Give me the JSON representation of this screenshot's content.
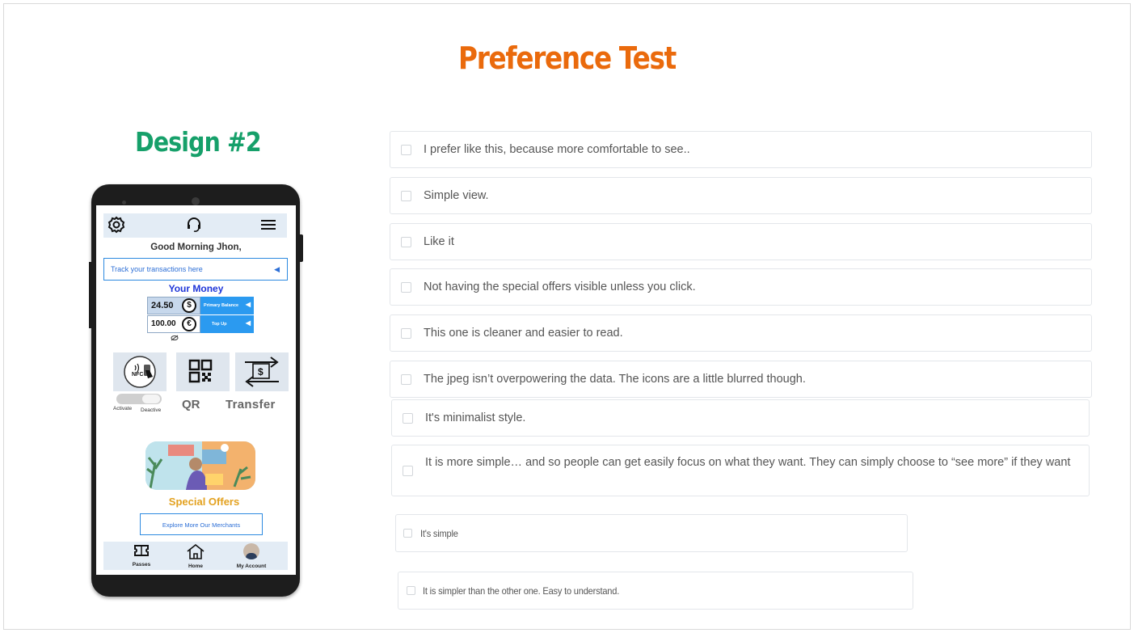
{
  "page": {
    "title": "Preference Test",
    "design_label": "Design #2"
  },
  "phone": {
    "greeting": "Good Morning Jhon,",
    "track_text": "Track your transactions here",
    "money_title": "Your Money",
    "balances": [
      {
        "amount": "24.50",
        "currency_symbol": "$",
        "action": "Primary Balance"
      },
      {
        "amount": "100.00",
        "currency_symbol": "€",
        "action": "Top Up"
      }
    ],
    "toggle": {
      "activate": "Activate",
      "deactive": "Deactive"
    },
    "tiles": {
      "nfc": "NFC",
      "qr": "QR",
      "transfer": "Transfer"
    },
    "offers_title": "Special Offers",
    "explore_button": "Explore More Our Merchants",
    "nav": [
      {
        "label": "Passes",
        "icon": "passes-icon"
      },
      {
        "label": "Home",
        "icon": "home-icon"
      },
      {
        "label": "My Account",
        "icon": "avatar"
      }
    ],
    "icons": [
      "gear-icon",
      "headset-icon",
      "menu-icon",
      "eye-slash-icon",
      "nfc-icon",
      "qr-icon",
      "transfer-icon"
    ]
  },
  "options": [
    "I prefer like this, because more comfortable to see..",
    "Simple view.",
    "Like it",
    "Not having the special offers visible unless you click.",
    "This one is cleaner and easier to read.",
    "The jpeg isn’t overpowering the data. The icons are a little blurred though.",
    "It's minimalist style.",
    "It is more simple… and so people can get easily focus on what they want. They can simply choose to “see more” if they want",
    "It's simple",
    "It is simpler than the other one. Easy to understand."
  ],
  "colors": {
    "title": "#ea6a0c",
    "design_label": "#16a06a",
    "accent_blue": "#2b9af0",
    "offers": "#e3a11f"
  }
}
